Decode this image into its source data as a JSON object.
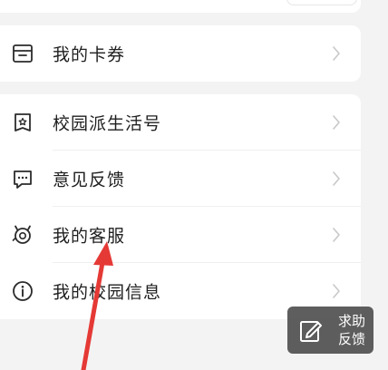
{
  "menu_coupon": {
    "items": [
      {
        "label": "我的卡券",
        "icon": "wallet-icon"
      }
    ]
  },
  "menu_main": {
    "items": [
      {
        "label": "校园派生活号",
        "icon": "star-card-icon"
      },
      {
        "label": "意见反馈",
        "icon": "chat-bubble-icon"
      },
      {
        "label": "我的客服",
        "icon": "customer-service-icon"
      },
      {
        "label": "我的校园信息",
        "icon": "info-icon"
      }
    ]
  },
  "help_button": {
    "label": "求助\n反馈",
    "icon": "edit-feedback-icon"
  },
  "colors": {
    "background": "#f3f3f3",
    "card": "#ffffff",
    "text": "#1f1f1f",
    "chevron": "#c8c8c8",
    "annotation_arrow": "#e53935",
    "help_button_bg": "#505050"
  }
}
